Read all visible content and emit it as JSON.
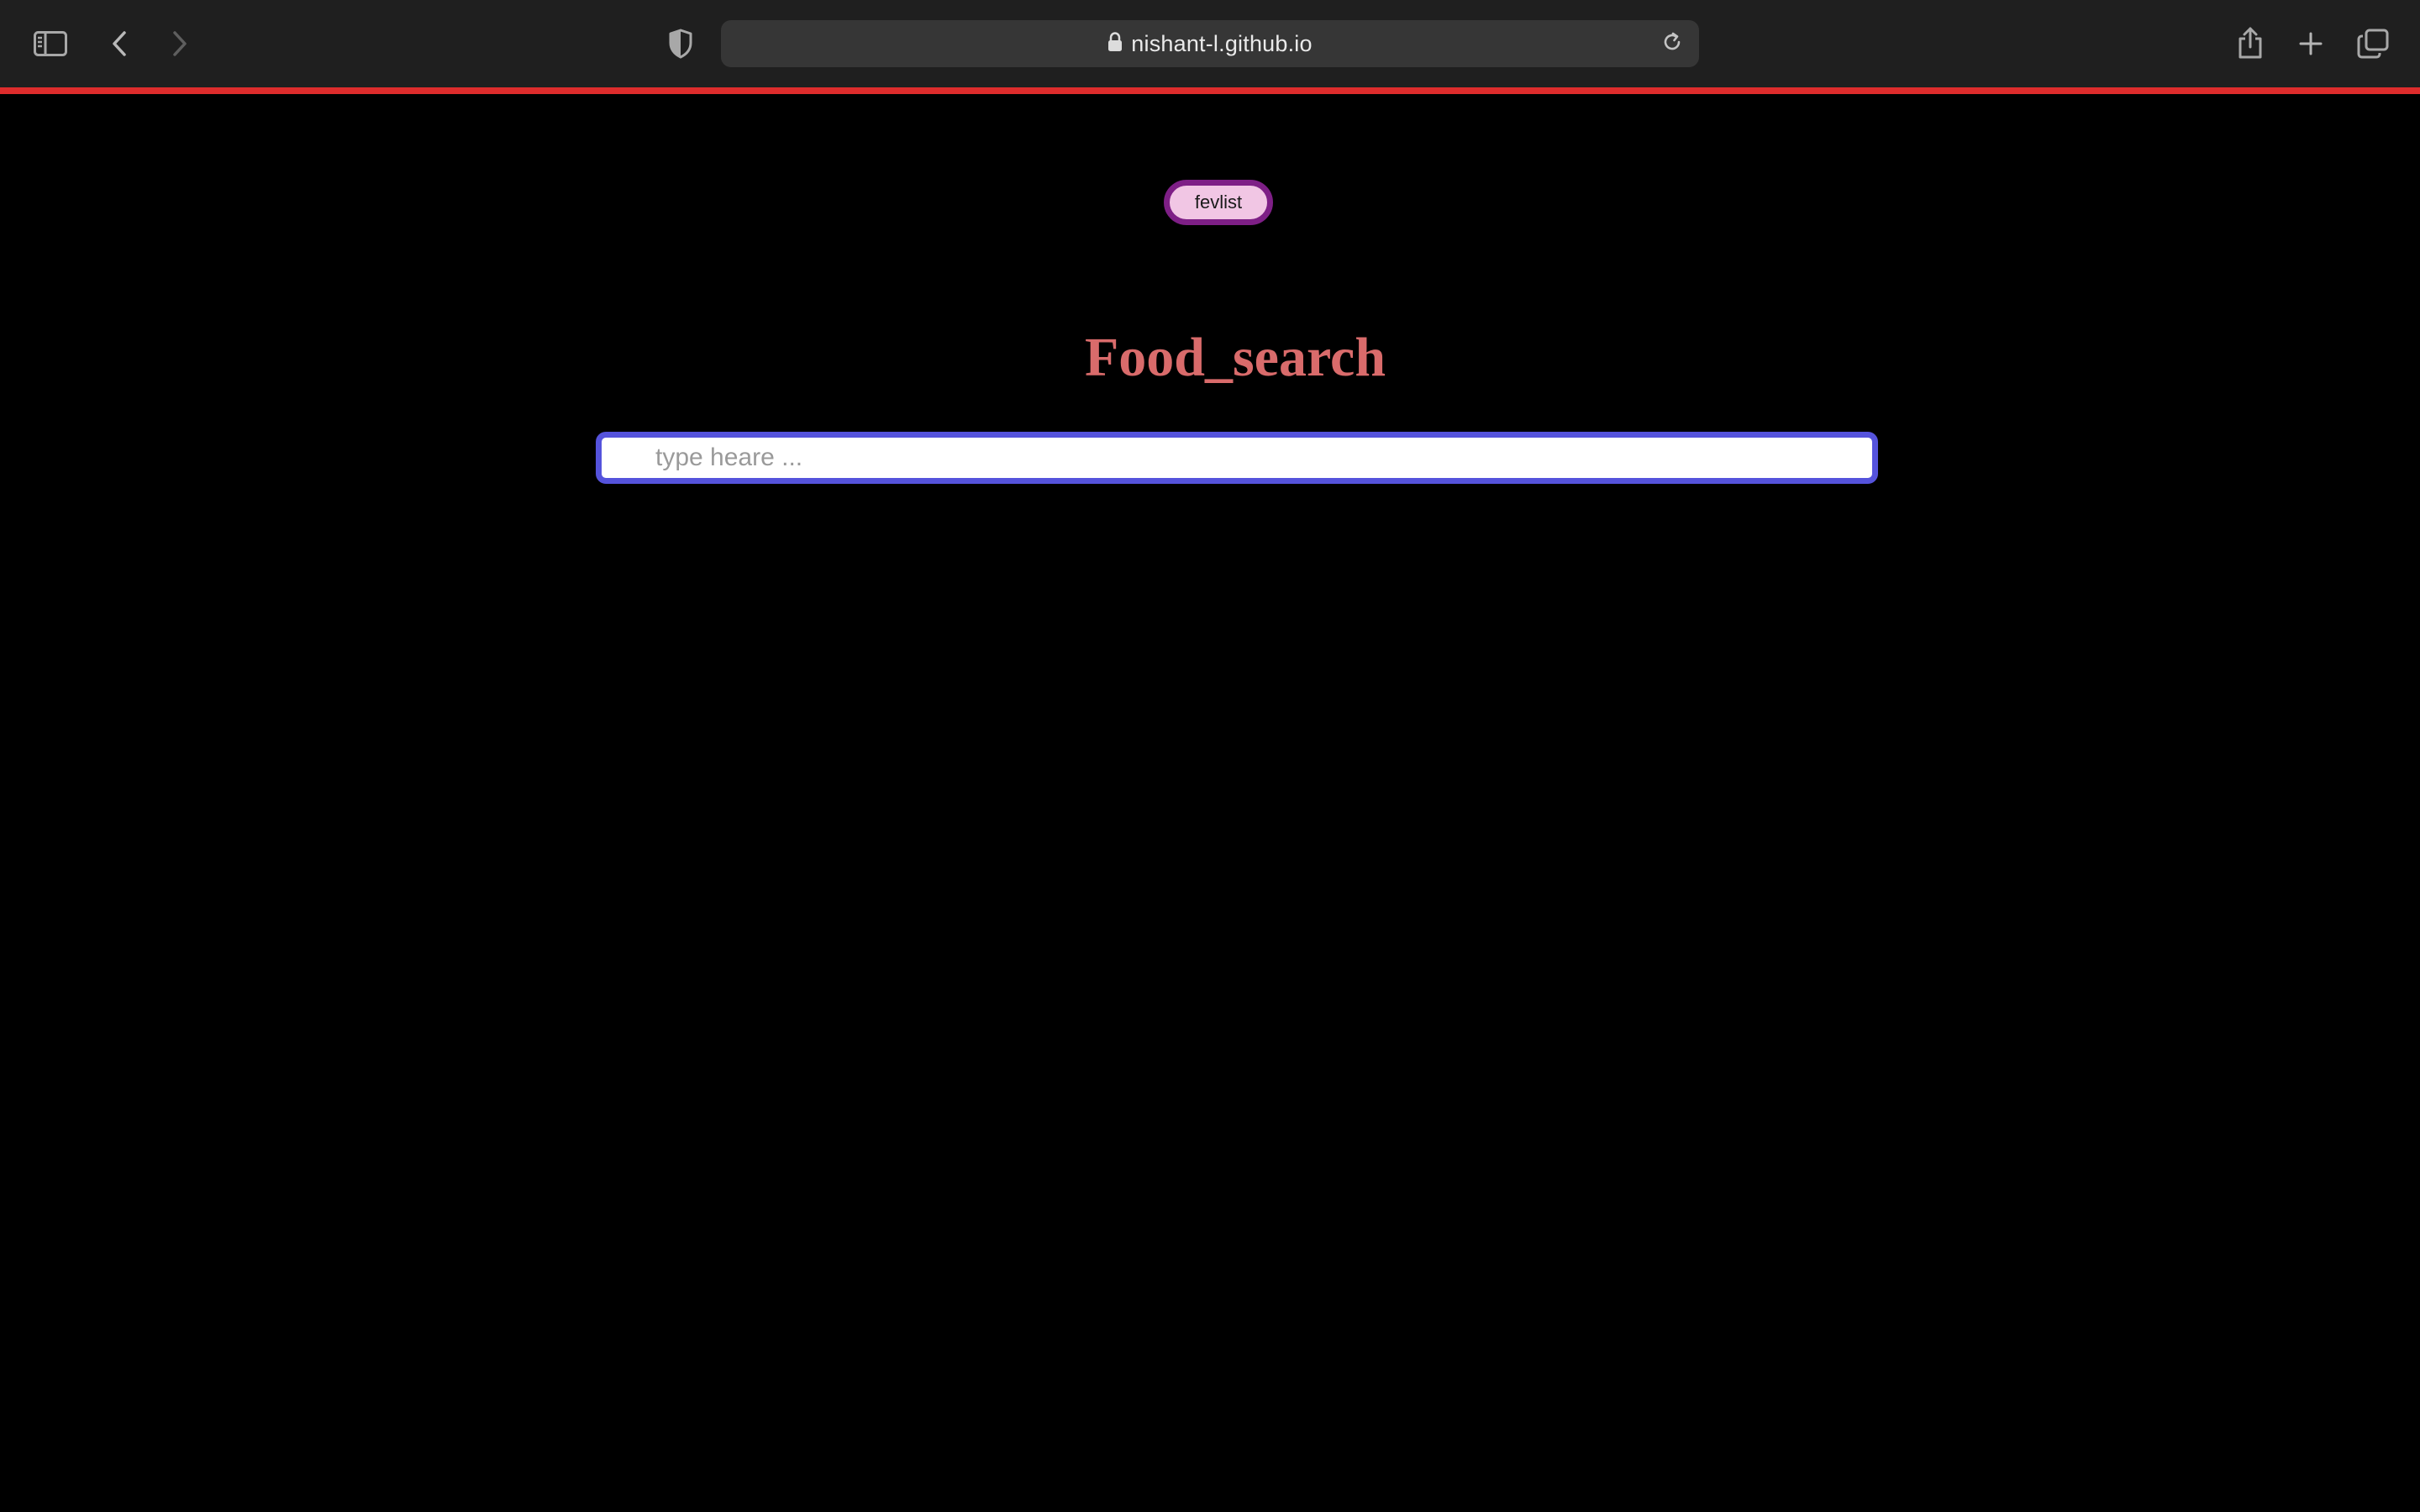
{
  "browser": {
    "url": "nishant-l.github.io",
    "icons": {
      "sidebar": "sidebar-icon",
      "back": "chevron-left-icon",
      "forward": "chevron-right-icon",
      "privacy": "shield-icon",
      "lock": "lock-icon",
      "reload": "reload-icon",
      "share": "share-icon",
      "new_tab": "plus-icon",
      "tab_overview": "tabs-icon"
    },
    "progress_color": "#dd2c2c"
  },
  "page": {
    "fevlist_label": "fevlist",
    "title": "Food_search",
    "search": {
      "placeholder": "type heare ...",
      "value": ""
    },
    "colors": {
      "background": "#000000",
      "title": "#d96b6b",
      "fevlist_fill": "#f1c6e4",
      "fevlist_border": "#7e1f86",
      "search_border": "#5553dc"
    }
  }
}
